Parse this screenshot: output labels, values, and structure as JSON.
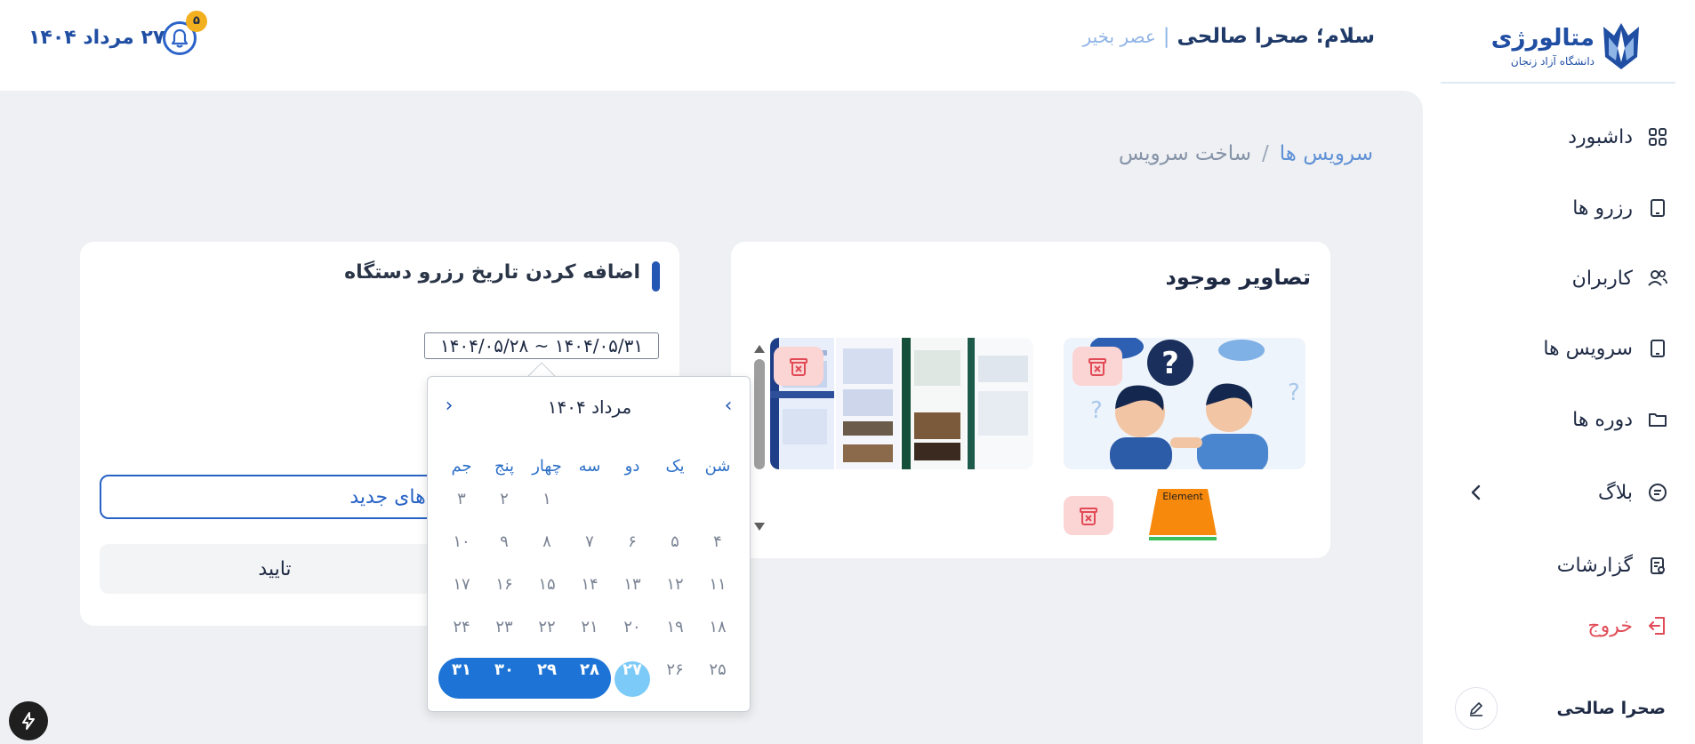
{
  "header": {
    "logo_title": "متالورژی",
    "logo_subtitle": "دانشگاه آزاد زنجان",
    "greeting": "سلام؛ صحرا صالحی",
    "greeting_sep": "|",
    "greeting_time": "عصر بخیر",
    "notifications_count": "۵",
    "date": "۲۷ مرداد ۱۴۰۴"
  },
  "sidebar": {
    "items": [
      {
        "label": "داشبورد",
        "icon": "dashboard-grid-icon"
      },
      {
        "label": "رزرو ها",
        "icon": "tablet-icon"
      },
      {
        "label": "کاربران",
        "icon": "users-icon"
      },
      {
        "label": "سرویس ها",
        "icon": "tablet-icon"
      },
      {
        "label": "دوره ها",
        "icon": "folder-icon"
      },
      {
        "label": "بلاگ",
        "icon": "blog-icon"
      },
      {
        "label": "گزارشات",
        "icon": "report-icon"
      },
      {
        "label": "خروج",
        "icon": "logout-icon"
      }
    ],
    "profile_name": "صحرا صالحی"
  },
  "breadcrumb": {
    "parent": "سرویس ها",
    "separator": "/",
    "current": "ساخت سرویس"
  },
  "images_card": {
    "title": "تصاویر موجود",
    "thumb_label": "Element"
  },
  "form_card": {
    "title": "اضافه کردن تاریخ رزرو دستگاه",
    "date_range": "۱۴۰۴/۰۵/۲۸ ~ ۱۴۰۴/۰۵/۳۱",
    "upload_label": "عکس‌های جدید",
    "confirm_label": "تایید"
  },
  "calendar": {
    "month_label": "مرداد ۱۴۰۴",
    "weekdays": [
      "شن",
      "یک",
      "دو",
      "سه",
      "چهار",
      "پنج",
      "جم"
    ],
    "weeks": [
      [
        "",
        "",
        "",
        "",
        "۱",
        "۲",
        "۳"
      ],
      [
        "۴",
        "۵",
        "۶",
        "۷",
        "۸",
        "۹",
        "۱۰"
      ],
      [
        "۱۱",
        "۱۲",
        "۱۳",
        "۱۴",
        "۱۵",
        "۱۶",
        "۱۷"
      ],
      [
        "۱۸",
        "۱۹",
        "۲۰",
        "۲۱",
        "۲۲",
        "۲۳",
        "۲۴"
      ],
      [
        "۲۵",
        "۲۶",
        "۲۷",
        "۲۸",
        "۲۹",
        "۳۰",
        "۳۱"
      ]
    ],
    "today": "۲۷",
    "range_start": "۲۸",
    "range_end": "۳۱"
  },
  "colors": {
    "brand": "#1f4ea3",
    "accent": "#1d74d6",
    "danger": "#e14b57",
    "background": "#eef0f3"
  }
}
